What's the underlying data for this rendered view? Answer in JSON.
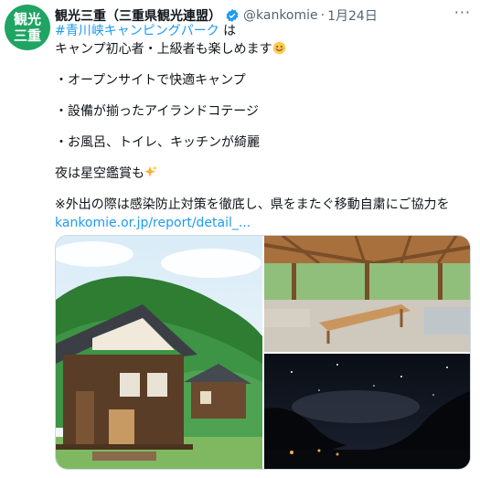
{
  "account": {
    "avatar_text_top": "観光",
    "avatar_text_bottom": "三重",
    "display_name": "観光三重（三重県観光連盟）",
    "handle": "@kankomie",
    "separator": "·",
    "date": "1月24日",
    "more_label": "···"
  },
  "tweet": {
    "hashtag": "#青川峡キャンピングパーク",
    "line1_suffix": " は",
    "line2": "キャンプ初心者・上級者も楽しめます",
    "bullet1": "・オープンサイトで快適キャンプ",
    "bullet2": "・設備が揃ったアイランドコテージ",
    "bullet3": "・お風呂、トイレ、キッチンが綺麗",
    "line_stars": "夜は星空鑑賞も",
    "notice": "※外出の際は感染防止対策を徹底し、県をまたぐ移動自粛にご協力を",
    "link": "kankomie.or.jp/report/detail_..."
  },
  "media": {
    "photos": [
      {
        "name": "cottage-photo"
      },
      {
        "name": "kitchen-pavilion-photo"
      },
      {
        "name": "night-sky-photo"
      }
    ]
  },
  "colors": {
    "accent": "#1d9bf0",
    "avatar_bg": "#1fa463",
    "secondary_text": "#536471"
  }
}
